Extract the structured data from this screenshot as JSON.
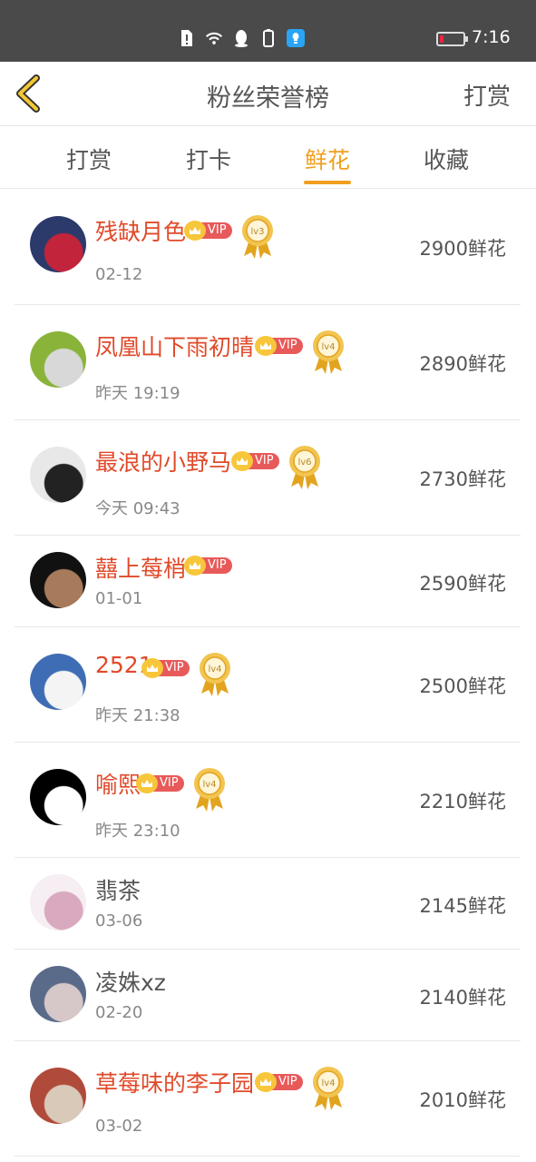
{
  "status": {
    "time": "7:16"
  },
  "nav": {
    "title": "粉丝荣誉榜",
    "right": "打赏"
  },
  "tabs": [
    "打赏",
    "打卡",
    "鲜花",
    "收藏"
  ],
  "active_tab": 2,
  "vip_label": "VIP",
  "rows": [
    {
      "name": "残缺月色",
      "date": "02-12",
      "amount": "2900鲜花",
      "vip": true,
      "level": "lv3",
      "avatar_colors": [
        "#2b3a6b",
        "#c2243b"
      ]
    },
    {
      "name": "凤凰山下雨初晴",
      "date": "昨天 19:19",
      "amount": "2890鲜花",
      "vip": true,
      "level": "lv4",
      "avatar_colors": [
        "#8ab33a",
        "#d8d8d8"
      ]
    },
    {
      "name": "最浪的小野马",
      "date": "今天 09:43",
      "amount": "2730鲜花",
      "vip": true,
      "level": "lv6",
      "avatar_colors": [
        "#e8e8e8",
        "#222222"
      ]
    },
    {
      "name": "囍上莓梢",
      "date": "01-01",
      "amount": "2590鲜花",
      "vip": true,
      "level": "",
      "avatar_colors": [
        "#111111",
        "#a67a5a"
      ]
    },
    {
      "name": "2521",
      "date": "昨天 21:38",
      "amount": "2500鲜花",
      "vip": true,
      "level": "lv4",
      "avatar_colors": [
        "#3f6db5",
        "#f4f4f4"
      ]
    },
    {
      "name": "喻熙",
      "date": "昨天 23:10",
      "amount": "2210鲜花",
      "vip": true,
      "level": "lv4",
      "avatar_colors": [
        "#000000",
        "#ffffff"
      ]
    },
    {
      "name": "翡茶",
      "date": "03-06",
      "amount": "2145鲜花",
      "vip": false,
      "level": "",
      "avatar_colors": [
        "#f6eef2",
        "#d9a9c0"
      ]
    },
    {
      "name": "凌姝xz",
      "date": "02-20",
      "amount": "2140鲜花",
      "vip": false,
      "level": "",
      "avatar_colors": [
        "#5a6b8a",
        "#d6c8c8"
      ]
    },
    {
      "name": "草莓味的李子园",
      "date": "03-02",
      "amount": "2010鲜花",
      "vip": true,
      "level": "lv4",
      "avatar_colors": [
        "#b04a3a",
        "#d9c9b9"
      ]
    }
  ]
}
